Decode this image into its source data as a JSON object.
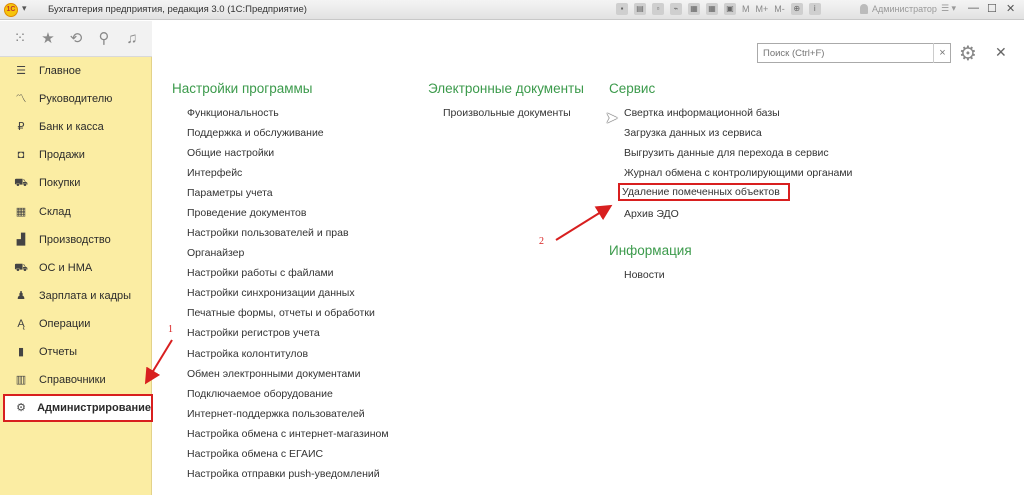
{
  "window": {
    "title": "Бухгалтерия предприятия, редакция 3.0  (1С:Предприятие)",
    "logo_text": "1С",
    "toolbar_m": "M",
    "toolbar_mplus": "M+",
    "toolbar_mminus": "M-",
    "user": "Администратор"
  },
  "search": {
    "placeholder": "Поиск (Ctrl+F)"
  },
  "sidebar": {
    "items": [
      {
        "label": "Главное",
        "icon": "hamburger-icon"
      },
      {
        "label": "Руководителю",
        "icon": "chart-line-icon"
      },
      {
        "label": "Банк и касса",
        "icon": "ruble-coin-icon"
      },
      {
        "label": "Продажи",
        "icon": "shopping-bag-icon"
      },
      {
        "label": "Покупки",
        "icon": "cart-icon"
      },
      {
        "label": "Склад",
        "icon": "warehouse-icon"
      },
      {
        "label": "Производство",
        "icon": "factory-icon"
      },
      {
        "label": "ОС и НМА",
        "icon": "truck-icon"
      },
      {
        "label": "Зарплата и кадры",
        "icon": "person-icon"
      },
      {
        "label": "Операции",
        "icon": "operations-icon"
      },
      {
        "label": "Отчеты",
        "icon": "bar-chart-icon"
      },
      {
        "label": "Справочники",
        "icon": "books-icon"
      },
      {
        "label": "Администрирование",
        "icon": "gear-icon"
      }
    ]
  },
  "sections": {
    "settings": {
      "title": "Настройки программы",
      "links": [
        "Функциональность",
        "Поддержка и обслуживание",
        "Общие настройки",
        "Интерфейс",
        "Параметры учета",
        "Проведение документов",
        "Настройки пользователей и прав",
        "Органайзер",
        "Настройки работы с файлами",
        "Настройки синхронизации данных",
        "Печатные формы, отчеты и обработки",
        "Настройки регистров учета",
        "Настройка колонтитулов",
        "Обмен электронными документами",
        "Подключаемое оборудование",
        "Интернет-поддержка пользователей",
        "Настройка обмена с интернет-магазином",
        "Настройка обмена с ЕГАИС",
        "Настройка отправки push-уведомлений"
      ]
    },
    "edocs": {
      "title": "Электронные документы",
      "links": [
        "Произвольные документы"
      ]
    },
    "service": {
      "title": "Сервис",
      "links": [
        "Свертка информационной базы",
        "Загрузка данных из сервиса",
        "Выгрузить данные для перехода в сервис",
        "Журнал обмена с контролирующими органами",
        "Удаление помеченных объектов",
        "Архив ЭДО"
      ]
    },
    "info": {
      "title": "Информация",
      "links": [
        "Новости"
      ]
    }
  },
  "annotations": {
    "step1": "1",
    "step2": "2"
  },
  "colors": {
    "sidebar_bg": "#fbeda3",
    "section_title": "#3b9a4b",
    "highlight": "#d81f1f"
  }
}
